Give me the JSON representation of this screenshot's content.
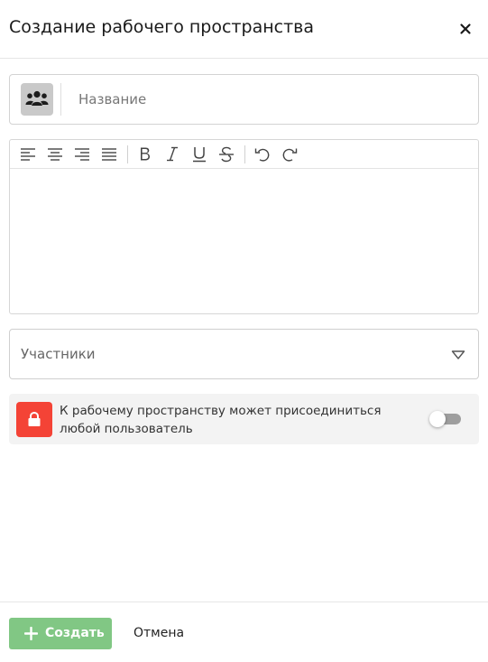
{
  "dialog": {
    "title": "Создание рабочего пространства"
  },
  "name_field": {
    "placeholder": "Название",
    "value": "",
    "icon": "users-group-icon"
  },
  "editor": {
    "toolbar": [
      {
        "name": "align-left-icon"
      },
      {
        "name": "align-center-icon"
      },
      {
        "name": "align-right-icon"
      },
      {
        "name": "align-justify-icon"
      },
      {
        "name": "bold-icon",
        "glyph": "B"
      },
      {
        "name": "italic-icon",
        "glyph": "I"
      },
      {
        "name": "underline-icon",
        "glyph": "U"
      },
      {
        "name": "strikethrough-icon",
        "glyph": "S"
      },
      {
        "name": "undo-icon"
      },
      {
        "name": "redo-icon"
      }
    ],
    "content": ""
  },
  "participants": {
    "label": "Участники",
    "icon": "chevron-down-icon"
  },
  "open_access": {
    "text": "К рабочему пространству может присоединиться любой пользователь",
    "enabled": false,
    "icon": "lock-icon"
  },
  "footer": {
    "create_label": "Создать",
    "cancel_label": "Отмена"
  },
  "colors": {
    "create_button": "#81c784",
    "lock_badge": "#f44336",
    "toggle_track": "#9e9e9e",
    "icon_box": "#c9c9c9"
  }
}
